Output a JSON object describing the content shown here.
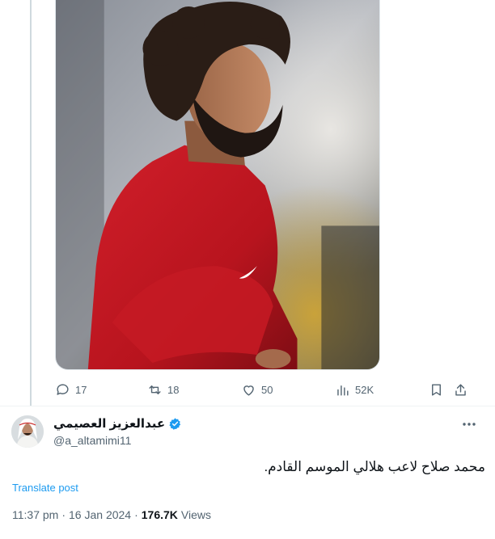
{
  "media": {
    "alt": "Mohamed Salah in a red training jacket"
  },
  "actions": {
    "replies": "17",
    "reposts": "18",
    "likes": "50",
    "views": "52K"
  },
  "author": {
    "display_name": "عبدالعزيز العصيمي",
    "handle": "@a_altamimi11",
    "verified_color": "#1d9bf0"
  },
  "tweet": {
    "text": "محمد صلاح لاعب هلالي الموسم القادم."
  },
  "translate_label": "Translate post",
  "meta": {
    "time": "11:37 pm",
    "separator": "·",
    "date": "16 Jan 2024",
    "views_count": "176.7K",
    "views_label": "Views"
  },
  "colors": {
    "accent": "#1d9bf0",
    "muted": "#536471",
    "text": "#0f1419"
  }
}
